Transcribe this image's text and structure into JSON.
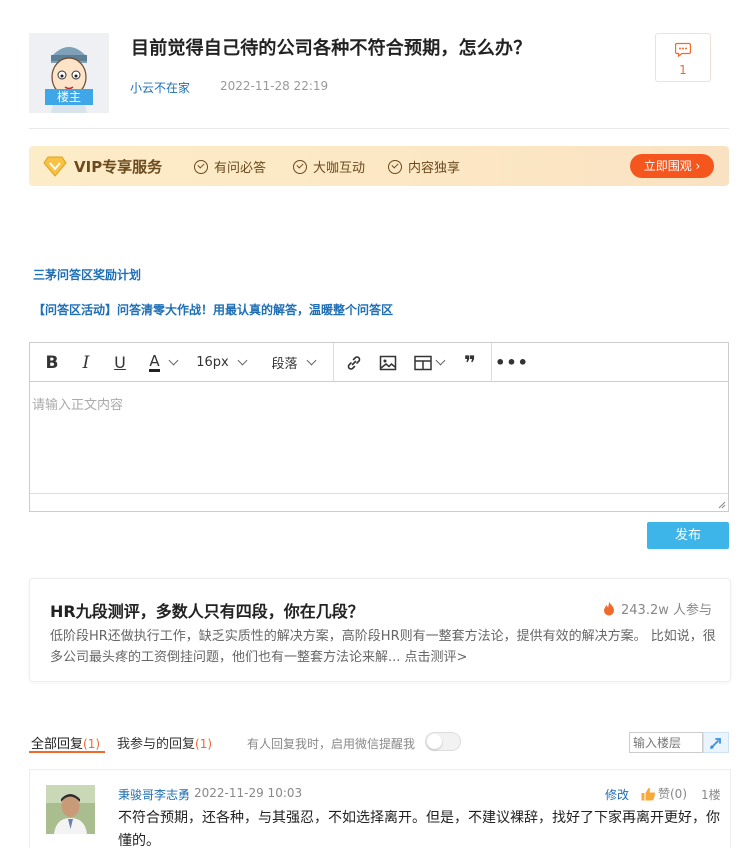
{
  "post": {
    "title": "目前觉得自己待的公司各种不符合预期，怎么办？",
    "author": "小云不在家",
    "time": "2022-11-28 22:19",
    "author_badge": "楼主",
    "comment_count": "1"
  },
  "vip": {
    "title": "VIP专享服务",
    "features": [
      "有问必答",
      "大咖互动",
      "内容独享"
    ],
    "button": "立即围观 ›"
  },
  "links": {
    "reward": "三茅问答区奖励计划",
    "activity": "【问答区活动】问答清零大作战！用最认真的解答，温暖整个问答区"
  },
  "editor": {
    "font_size": "16px",
    "paragraph": "段落",
    "placeholder": "请输入正文内容",
    "publish": "发布"
  },
  "card": {
    "title": "HR九段测评，多数人只有四段，你在几段？",
    "participants": "243.2w 人参与",
    "description": "低阶段HR还做执行工作，缺乏实质性的解决方案，高阶段HR则有一整套方法论，提供有效的解决方案。 比如说，很多公司最头疼的工资倒挂问题，他们也有一整套方法论来解... 点击测评>"
  },
  "replies_section": {
    "tab_all": "全部回复",
    "tab_all_count": "(1)",
    "tab_mine": "我参与的回复",
    "tab_mine_count": "(1)",
    "notify_text": "有人回复我时，启用微信提醒我",
    "floor_placeholder": "输入楼层"
  },
  "reply": {
    "author": "秉骏哥李志勇",
    "time": "2022-11-29 10:03",
    "edit": "修改",
    "like": "赞(0)",
    "floor": "1楼",
    "content": "不符合预期，还各种，与其强忍，不如选择离开。但是，不建议裸辞，找好了下家再离开更好，你懂的。"
  },
  "colors": {
    "link_blue": "#1e6fb6",
    "accent_orange": "#f06a2c",
    "vip_button": "#f5561e",
    "publish_button": "#3db5e8"
  }
}
